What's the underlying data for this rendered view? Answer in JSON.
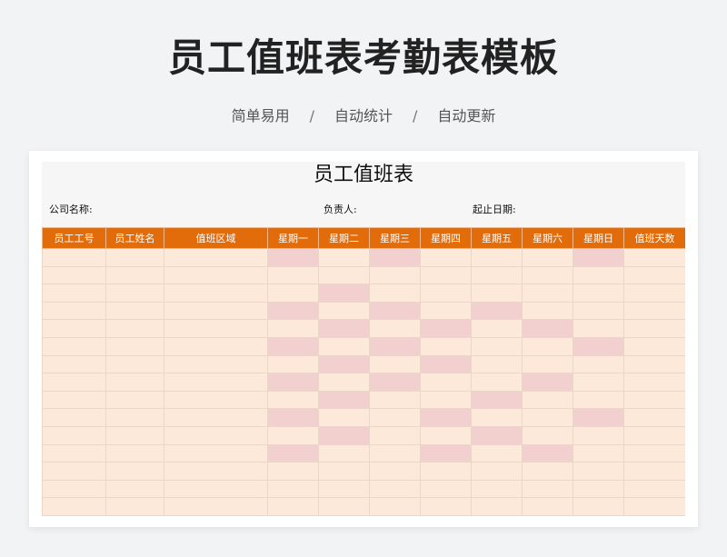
{
  "header": {
    "title": "员工值班表考勤表模板",
    "tags": [
      "简单易用",
      "自动统计",
      "自动更新"
    ],
    "separator": "/"
  },
  "sheet": {
    "title": "员工值班表",
    "company_label": "公司名称:",
    "owner_label": "负责人:",
    "date_label": "起止日期:",
    "columns": [
      "员工工号",
      "员工姓名",
      "值班区域",
      "星期一",
      "星期二",
      "星期三",
      "星期四",
      "星期五",
      "星期六",
      "星期日",
      "值班天数"
    ],
    "colors": {
      "header": "#e36c0a",
      "cell": "#fde9d9",
      "duty": "#f2d0cf"
    },
    "duty_grid": [
      [
        1,
        0,
        1,
        0,
        0,
        0,
        1
      ],
      [
        0,
        0,
        0,
        0,
        0,
        0,
        0
      ],
      [
        0,
        1,
        0,
        0,
        0,
        0,
        0
      ],
      [
        1,
        0,
        1,
        0,
        1,
        0,
        0
      ],
      [
        0,
        1,
        0,
        1,
        0,
        1,
        0
      ],
      [
        1,
        0,
        1,
        0,
        0,
        0,
        1
      ],
      [
        0,
        1,
        0,
        1,
        0,
        0,
        0
      ],
      [
        1,
        0,
        1,
        0,
        0,
        1,
        0
      ],
      [
        0,
        1,
        0,
        0,
        1,
        0,
        0
      ],
      [
        1,
        0,
        0,
        1,
        0,
        0,
        1
      ],
      [
        0,
        1,
        0,
        0,
        1,
        0,
        0
      ],
      [
        1,
        0,
        0,
        1,
        0,
        1,
        0
      ],
      [
        0,
        0,
        0,
        0,
        0,
        0,
        0
      ],
      [
        0,
        0,
        0,
        0,
        0,
        0,
        0
      ],
      [
        0,
        0,
        0,
        0,
        0,
        0,
        0
      ]
    ]
  }
}
